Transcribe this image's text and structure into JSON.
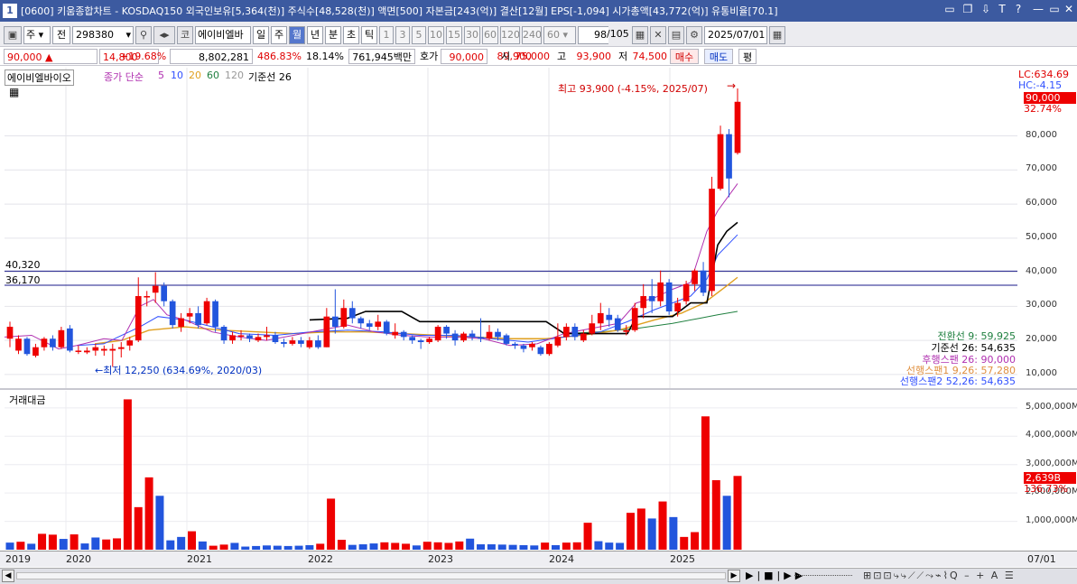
{
  "window": {
    "number": "1",
    "title": "[0600] 키움종합차트 - KOSDAQ150 외국인보유[5,364(천)] 주식수[48,528(천)] 액면[500] 자본금[243(억)] 결산[12월] EPS[-1,094] 시가총액[43,772(억)] 유통비율[70.1]",
    "controls": [
      "▭",
      "❐",
      "⇩",
      "T",
      "?",
      "—",
      "▭",
      "✕"
    ]
  },
  "toolbar": {
    "market_mode": "주",
    "prev_label": "전",
    "code": "298380",
    "exchange": "코",
    "stock_name": "에이비엘바",
    "periods": [
      "일",
      "주",
      "월",
      "년",
      "분",
      "초",
      "틱"
    ],
    "selected_period": "월",
    "minute_options": [
      "1",
      "3",
      "5",
      "10",
      "15",
      "30",
      "60",
      "120",
      "240"
    ],
    "interval_value": "60",
    "count": "98",
    "count_total": "/105",
    "date": "2025/07/01"
  },
  "quote": {
    "price": "90,000",
    "change": "14,800",
    "change_pct": "+19.68%",
    "volume": "8,802,281",
    "volume_ratio": "486.83%",
    "turnover": "18.14%",
    "amount": "761,945백만",
    "bid_label": "호가",
    "bid1": "90,000",
    "bid2": "89,900",
    "open_label": "시",
    "open": "75,000",
    "high_label": "고",
    "high": "93,900",
    "low_label": "저",
    "low": "74,500",
    "buy_button": "매수",
    "sell_button": "매도",
    "eval_button": "평"
  },
  "price_panel": {
    "stock_label": "에이비엘바이오",
    "ma_label": "종가 단순",
    "ma_periods": [
      "5",
      "10",
      "20",
      "60",
      "120"
    ],
    "ma_colors": [
      "#b030b0",
      "#3050ff",
      "#e0a020",
      "#208040",
      "#b0b0b0"
    ],
    "kijun_label": "기준선 26",
    "lc_label": "LC:634.69",
    "hc_label": "HC:-4.15",
    "current_price_tag": "90,000",
    "current_pct_tag": "32.74%",
    "high_annotation": "최고 93,900 (-4.15%, 2025/07)",
    "low_annotation": "←최저 12,250 (634.69%, 2020/03)",
    "hline1_label": "40,320",
    "hline2_label": "36,170",
    "ichimoku": [
      {
        "text": "전환선 9: 59,925",
        "color": "#208040"
      },
      {
        "text": "기준선 26: 54,635",
        "color": "#000000"
      },
      {
        "text": "후행스팬 26: 90,000",
        "color": "#b030b0"
      },
      {
        "text": "선행스팬1 9,26: 57,280",
        "color": "#e09040"
      },
      {
        "text": "선행스팬2 52,26: 54,635",
        "color": "#3050ff"
      }
    ]
  },
  "volume_panel": {
    "label": "거래대금",
    "current_tag": "2,639B",
    "pct_tag": "136.73%"
  },
  "date_axis": [
    "2019",
    "2020",
    "2021",
    "2022",
    "2023",
    "2024",
    "2025"
  ],
  "date_axis_right": "07/01",
  "colors": {
    "up": "#ee0000",
    "down": "#2255dd",
    "title_bar": "#3c5aa0"
  },
  "chart_data": {
    "type": "candlestick",
    "price_axis": {
      "ticks": [
        "10,000",
        "20,000",
        "30,000",
        "40,000",
        "50,000",
        "60,000",
        "70,000",
        "80,000"
      ],
      "range": [
        6000,
        100000
      ]
    },
    "volume_axis": {
      "ticks": [
        "1,000,000M",
        "2,000,000M",
        "3,000,000M",
        "4,000,000M",
        "5,000,000M"
      ],
      "range": [
        0,
        5600000
      ]
    },
    "hlines": [
      40320,
      36170
    ],
    "candles": [
      [
        20500,
        24000,
        18000,
        25500
      ],
      [
        17000,
        20500,
        16000,
        21500
      ],
      [
        20500,
        16000,
        15500,
        21000
      ],
      [
        15500,
        18000,
        15000,
        19000
      ],
      [
        18000,
        20500,
        17000,
        21000
      ],
      [
        20500,
        18000,
        17000,
        21500
      ],
      [
        18000,
        23000,
        17500,
        24000
      ],
      [
        23500,
        17000,
        16500,
        24500
      ],
      [
        17000,
        17000,
        16000,
        18500
      ],
      [
        16500,
        17000,
        16000,
        18000
      ],
      [
        17000,
        18000,
        15500,
        19000
      ],
      [
        17000,
        17500,
        15500,
        18500
      ],
      [
        17000,
        17500,
        12250,
        19000
      ],
      [
        17500,
        18000,
        15000,
        19500
      ],
      [
        18500,
        20000,
        17000,
        21000
      ],
      [
        20000,
        33000,
        19500,
        38500
      ],
      [
        33000,
        33000,
        30000,
        34500
      ],
      [
        34000,
        36000,
        31000,
        40000
      ],
      [
        36000,
        31500,
        30000,
        37000
      ],
      [
        31500,
        24500,
        23500,
        32000
      ],
      [
        24000,
        26500,
        22500,
        28000
      ],
      [
        27000,
        28000,
        25000,
        29500
      ],
      [
        28000,
        24500,
        23500,
        30000
      ],
      [
        25000,
        31500,
        24500,
        32500
      ],
      [
        31500,
        24000,
        22500,
        32000
      ],
      [
        24000,
        20000,
        19000,
        24500
      ],
      [
        20000,
        21500,
        19000,
        22500
      ],
      [
        21500,
        21500,
        20000,
        23000
      ],
      [
        21500,
        20500,
        19500,
        22000
      ],
      [
        20000,
        21000,
        19500,
        22000
      ],
      [
        21000,
        21500,
        20000,
        24000
      ],
      [
        21500,
        19500,
        19000,
        22500
      ],
      [
        19500,
        19000,
        18000,
        20500
      ],
      [
        19000,
        20000,
        18500,
        21000
      ],
      [
        20000,
        19000,
        18000,
        21000
      ],
      [
        18000,
        20000,
        17500,
        21000
      ],
      [
        20000,
        18000,
        17500,
        21500
      ],
      [
        18000,
        27000,
        18000,
        29500
      ],
      [
        27000,
        24000,
        22000,
        35000
      ],
      [
        24000,
        29500,
        23500,
        32000
      ],
      [
        29500,
        26500,
        25000,
        31500
      ],
      [
        26500,
        25000,
        23500,
        27000
      ],
      [
        25000,
        24000,
        23000,
        26000
      ],
      [
        24000,
        25500,
        23000,
        27500
      ],
      [
        25500,
        22000,
        21500,
        26000
      ],
      [
        21500,
        22500,
        20500,
        25000
      ],
      [
        22500,
        21000,
        20000,
        23000
      ],
      [
        21000,
        20000,
        19000,
        21500
      ],
      [
        20000,
        19500,
        17500,
        20500
      ],
      [
        19500,
        20500,
        19000,
        21000
      ],
      [
        20000,
        24000,
        19500,
        24500
      ],
      [
        24000,
        22000,
        20500,
        24500
      ],
      [
        22000,
        20000,
        18500,
        23000
      ],
      [
        20000,
        22000,
        19500,
        22500
      ],
      [
        22000,
        21000,
        20000,
        23000
      ],
      [
        21000,
        20500,
        19500,
        26500
      ],
      [
        20500,
        22500,
        20000,
        24500
      ],
      [
        22500,
        21000,
        20000,
        23500
      ],
      [
        21500,
        19000,
        18500,
        22000
      ],
      [
        19000,
        18500,
        17500,
        19500
      ],
      [
        18500,
        17500,
        16500,
        19000
      ],
      [
        18000,
        19000,
        17000,
        19500
      ],
      [
        18000,
        16000,
        15500,
        18500
      ],
      [
        16000,
        19000,
        15500,
        19500
      ],
      [
        18500,
        21000,
        18000,
        25000
      ],
      [
        21000,
        24000,
        20000,
        25000
      ],
      [
        24000,
        21000,
        20000,
        25000
      ],
      [
        20000,
        22000,
        19500,
        23000
      ],
      [
        22000,
        25000,
        21500,
        27500
      ],
      [
        25000,
        28000,
        23000,
        31000
      ],
      [
        27500,
        26000,
        24000,
        29500
      ],
      [
        26500,
        23000,
        22500,
        27500
      ],
      [
        22500,
        23000,
        21500,
        24500
      ],
      [
        23000,
        29500,
        22500,
        31000
      ],
      [
        29500,
        33000,
        26500,
        36500
      ],
      [
        33000,
        31500,
        28000,
        38000
      ],
      [
        31500,
        37000,
        30000,
        40500
      ],
      [
        37000,
        28500,
        27500,
        38000
      ],
      [
        28500,
        31000,
        27000,
        32500
      ],
      [
        31500,
        36500,
        30500,
        37500
      ],
      [
        36500,
        40500,
        34500,
        41000
      ],
      [
        40500,
        34000,
        33000,
        43000
      ],
      [
        34500,
        64500,
        33000,
        68000
      ],
      [
        64500,
        80500,
        64000,
        83000
      ],
      [
        80500,
        67500,
        62000,
        82000
      ],
      [
        75000,
        90000,
        74500,
        93900
      ]
    ],
    "volume": [
      [
        250000,
        "down"
      ],
      [
        280000,
        "up"
      ],
      [
        210000,
        "down"
      ],
      [
        560000,
        "up"
      ],
      [
        530000,
        "up"
      ],
      [
        380000,
        "down"
      ],
      [
        540000,
        "up"
      ],
      [
        220000,
        "down"
      ],
      [
        430000,
        "down"
      ],
      [
        360000,
        "up"
      ],
      [
        400000,
        "up"
      ],
      [
        5300000,
        "up"
      ],
      [
        1500000,
        "up"
      ],
      [
        2550000,
        "up"
      ],
      [
        1900000,
        "down"
      ],
      [
        330000,
        "down"
      ],
      [
        450000,
        "down"
      ],
      [
        650000,
        "up"
      ],
      [
        290000,
        "down"
      ],
      [
        140000,
        "up"
      ],
      [
        180000,
        "up"
      ],
      [
        240000,
        "down"
      ],
      [
        110000,
        "down"
      ],
      [
        130000,
        "down"
      ],
      [
        150000,
        "down"
      ],
      [
        140000,
        "down"
      ],
      [
        130000,
        "down"
      ],
      [
        140000,
        "down"
      ],
      [
        160000,
        "down"
      ],
      [
        210000,
        "up"
      ],
      [
        1800000,
        "up"
      ],
      [
        350000,
        "up"
      ],
      [
        170000,
        "down"
      ],
      [
        190000,
        "down"
      ],
      [
        220000,
        "down"
      ],
      [
        260000,
        "up"
      ],
      [
        240000,
        "up"
      ],
      [
        210000,
        "up"
      ],
      [
        150000,
        "down"
      ],
      [
        280000,
        "up"
      ],
      [
        260000,
        "up"
      ],
      [
        240000,
        "up"
      ],
      [
        290000,
        "up"
      ],
      [
        390000,
        "down"
      ],
      [
        190000,
        "down"
      ],
      [
        190000,
        "down"
      ],
      [
        180000,
        "down"
      ],
      [
        170000,
        "down"
      ],
      [
        160000,
        "down"
      ],
      [
        150000,
        "down"
      ],
      [
        250000,
        "up"
      ],
      [
        160000,
        "down"
      ],
      [
        250000,
        "up"
      ],
      [
        260000,
        "up"
      ],
      [
        950000,
        "up"
      ],
      [
        300000,
        "down"
      ],
      [
        250000,
        "down"
      ],
      [
        240000,
        "down"
      ],
      [
        1300000,
        "up"
      ],
      [
        1450000,
        "up"
      ],
      [
        1100000,
        "down"
      ],
      [
        1700000,
        "up"
      ],
      [
        1150000,
        "down"
      ],
      [
        450000,
        "up"
      ],
      [
        620000,
        "up"
      ],
      [
        4700000,
        "up"
      ],
      [
        2450000,
        "up"
      ],
      [
        1900000,
        "down"
      ],
      [
        2600000,
        "up"
      ]
    ],
    "volume_start_index": 18,
    "x_extent": [
      0,
      1122
    ],
    "kijun": [
      [
        338,
        26000
      ],
      [
        380,
        26500
      ],
      [
        400,
        28500
      ],
      [
        440,
        28500
      ],
      [
        460,
        25500
      ],
      [
        600,
        25500
      ],
      [
        620,
        22000
      ],
      [
        690,
        22000
      ],
      [
        700,
        27000
      ],
      [
        740,
        27000
      ],
      [
        760,
        31000
      ],
      [
        778,
        31000
      ],
      [
        790,
        48000
      ],
      [
        800,
        52000
      ],
      [
        812,
        54635
      ]
    ],
    "ma5": [
      [
        0,
        21000
      ],
      [
        30,
        21500
      ],
      [
        60,
        17500
      ],
      [
        80,
        18500
      ],
      [
        110,
        20500
      ],
      [
        130,
        20000
      ],
      [
        150,
        30000
      ],
      [
        165,
        32000
      ],
      [
        180,
        27500
      ],
      [
        200,
        26000
      ],
      [
        230,
        22500
      ],
      [
        260,
        21000
      ],
      [
        290,
        20000
      ],
      [
        320,
        21500
      ],
      [
        350,
        23000
      ],
      [
        380,
        24500
      ],
      [
        410,
        22500
      ],
      [
        440,
        21500
      ],
      [
        470,
        21000
      ],
      [
        500,
        21000
      ],
      [
        530,
        20500
      ],
      [
        560,
        18500
      ],
      [
        590,
        19000
      ],
      [
        620,
        22000
      ],
      [
        650,
        23500
      ],
      [
        680,
        25000
      ],
      [
        700,
        31000
      ],
      [
        720,
        32500
      ],
      [
        740,
        35000
      ],
      [
        760,
        37000
      ],
      [
        778,
        52000
      ],
      [
        790,
        58000
      ],
      [
        812,
        66000
      ]
    ],
    "ma10": [
      [
        80,
        18500
      ],
      [
        110,
        19000
      ],
      [
        150,
        24000
      ],
      [
        170,
        27000
      ],
      [
        200,
        26000
      ],
      [
        230,
        24000
      ],
      [
        260,
        22000
      ],
      [
        300,
        21500
      ],
      [
        340,
        22500
      ],
      [
        380,
        23000
      ],
      [
        420,
        22500
      ],
      [
        460,
        21500
      ],
      [
        500,
        21500
      ],
      [
        540,
        20500
      ],
      [
        580,
        19500
      ],
      [
        620,
        21000
      ],
      [
        660,
        22500
      ],
      [
        690,
        25500
      ],
      [
        720,
        29000
      ],
      [
        760,
        33000
      ],
      [
        778,
        38000
      ],
      [
        790,
        45000
      ],
      [
        812,
        51000
      ]
    ],
    "ma20": [
      [
        100,
        19000
      ],
      [
        130,
        20000
      ],
      [
        160,
        23000
      ],
      [
        200,
        24000
      ],
      [
        240,
        23000
      ],
      [
        280,
        22500
      ],
      [
        320,
        22000
      ],
      [
        360,
        22500
      ],
      [
        400,
        22500
      ],
      [
        440,
        22000
      ],
      [
        480,
        21500
      ],
      [
        520,
        21000
      ],
      [
        560,
        20500
      ],
      [
        600,
        20500
      ],
      [
        640,
        21500
      ],
      [
        680,
        23000
      ],
      [
        720,
        26000
      ],
      [
        750,
        28000
      ],
      [
        775,
        31000
      ],
      [
        800,
        36000
      ],
      [
        812,
        38500
      ]
    ],
    "ma60": [
      [
        620,
        22000
      ],
      [
        660,
        22500
      ],
      [
        700,
        23500
      ],
      [
        740,
        25000
      ],
      [
        770,
        26500
      ],
      [
        790,
        27500
      ],
      [
        812,
        28500
      ]
    ]
  }
}
